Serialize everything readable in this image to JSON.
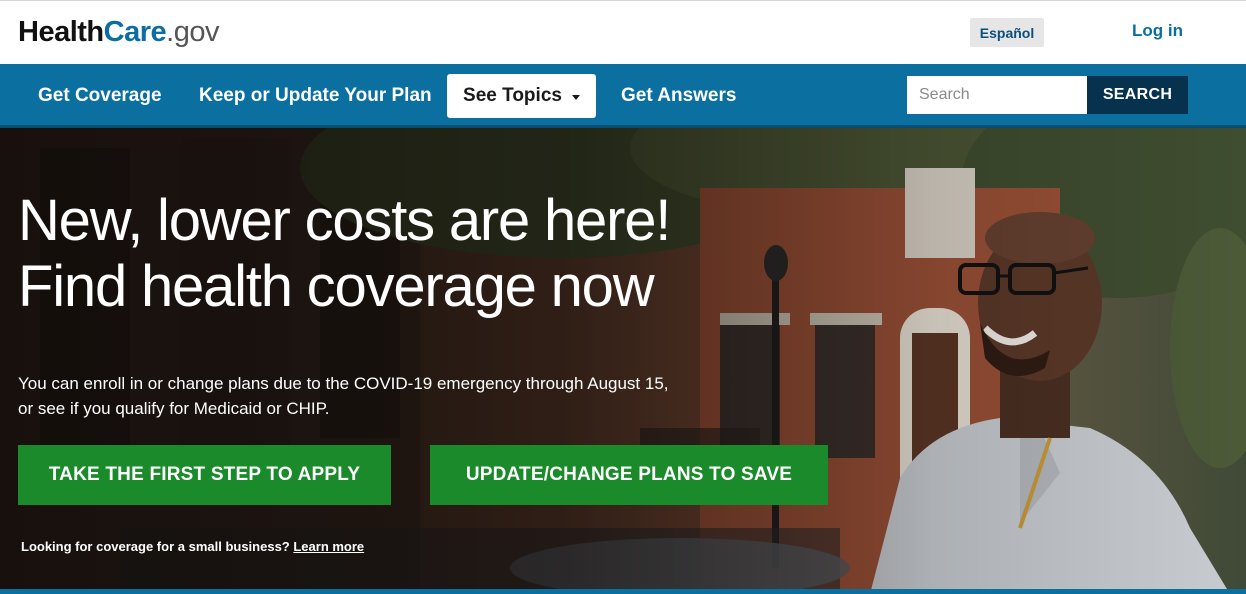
{
  "brand": {
    "logo_part1": "Health",
    "logo_part2": "Care",
    "logo_part3": ".gov"
  },
  "header": {
    "language_label": "Español",
    "login_label": "Log in"
  },
  "nav": {
    "items": [
      "Get Coverage",
      "Keep or Update Your Plan",
      "See Topics",
      "Get Answers"
    ],
    "search_placeholder": "Search",
    "search_button": "SEARCH"
  },
  "hero": {
    "headline_line1": "New, lower costs are here!",
    "headline_line2": "Find health coverage now",
    "subtext_line1": "You can enroll in or change plans due to the COVID-19 emergency through August 15,",
    "subtext_line2": "or see if you qualify for Medicaid or CHIP.",
    "cta_apply": "TAKE THE FIRST STEP TO APPLY",
    "cta_update": "UPDATE/CHANGE PLANS TO SAVE",
    "small_business_text": "Looking for coverage for a small business?",
    "small_business_link": "Learn more"
  },
  "colors": {
    "brand_blue": "#0b6fa0",
    "dark_navy": "#06324d",
    "cta_green": "#1b8a2a"
  },
  "icons": {
    "topics_dropdown": "caret-down-icon"
  }
}
